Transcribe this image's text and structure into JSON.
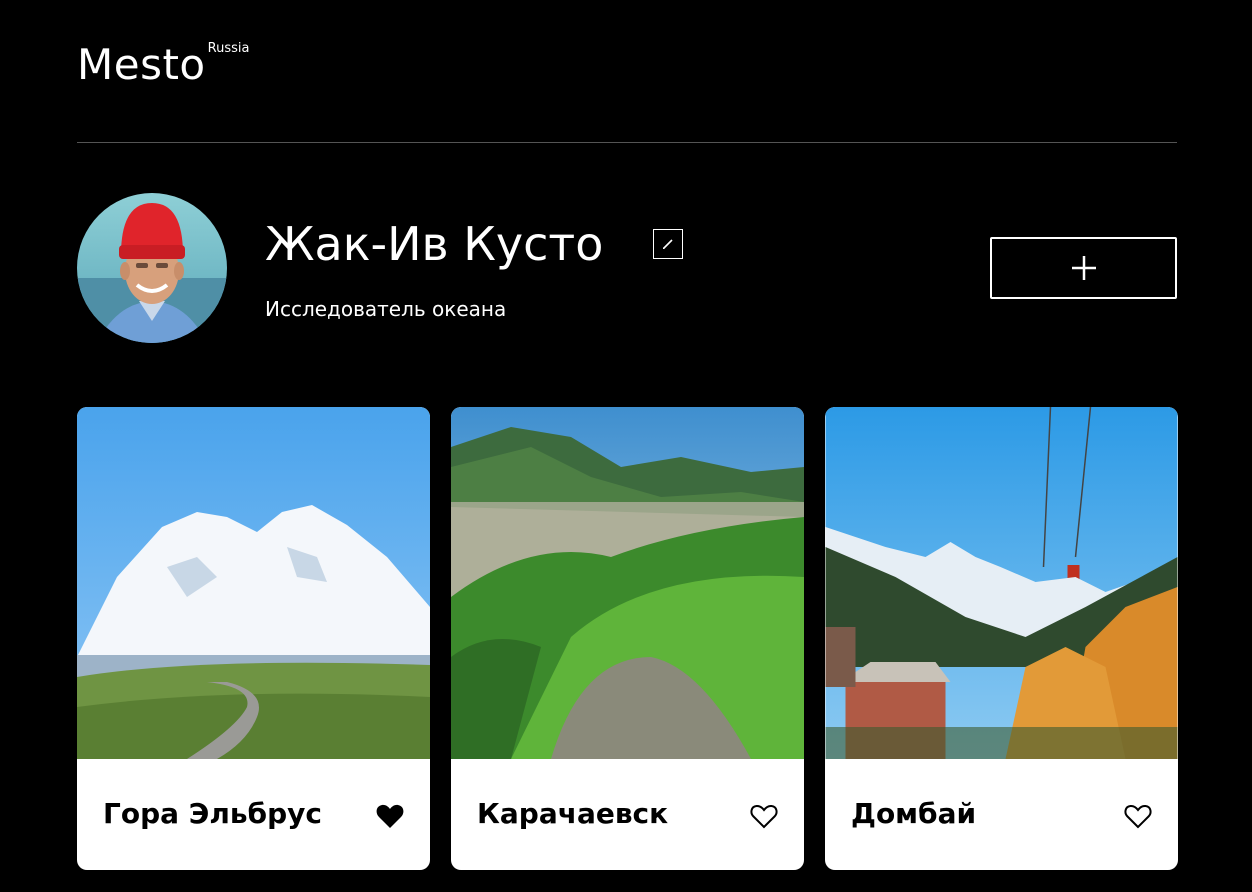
{
  "header": {
    "logo": "Mesto",
    "logo_sup": "Russia"
  },
  "profile": {
    "name": "Жак-Ив Кусто",
    "about": "Исследователь океана"
  },
  "cards": [
    {
      "title": "Гора Эльбрус",
      "liked": true
    },
    {
      "title": "Карачаевск",
      "liked": false
    },
    {
      "title": "Домбай",
      "liked": false
    }
  ],
  "colors": {
    "background": "#000000",
    "text": "#ffffff",
    "card_bg": "#ffffff",
    "card_text": "#000000",
    "divider": "#545454"
  },
  "icons": {
    "edit": "pencil-icon",
    "add": "plus-icon",
    "like_active": "heart-filled-icon",
    "like": "heart-outline-icon"
  }
}
